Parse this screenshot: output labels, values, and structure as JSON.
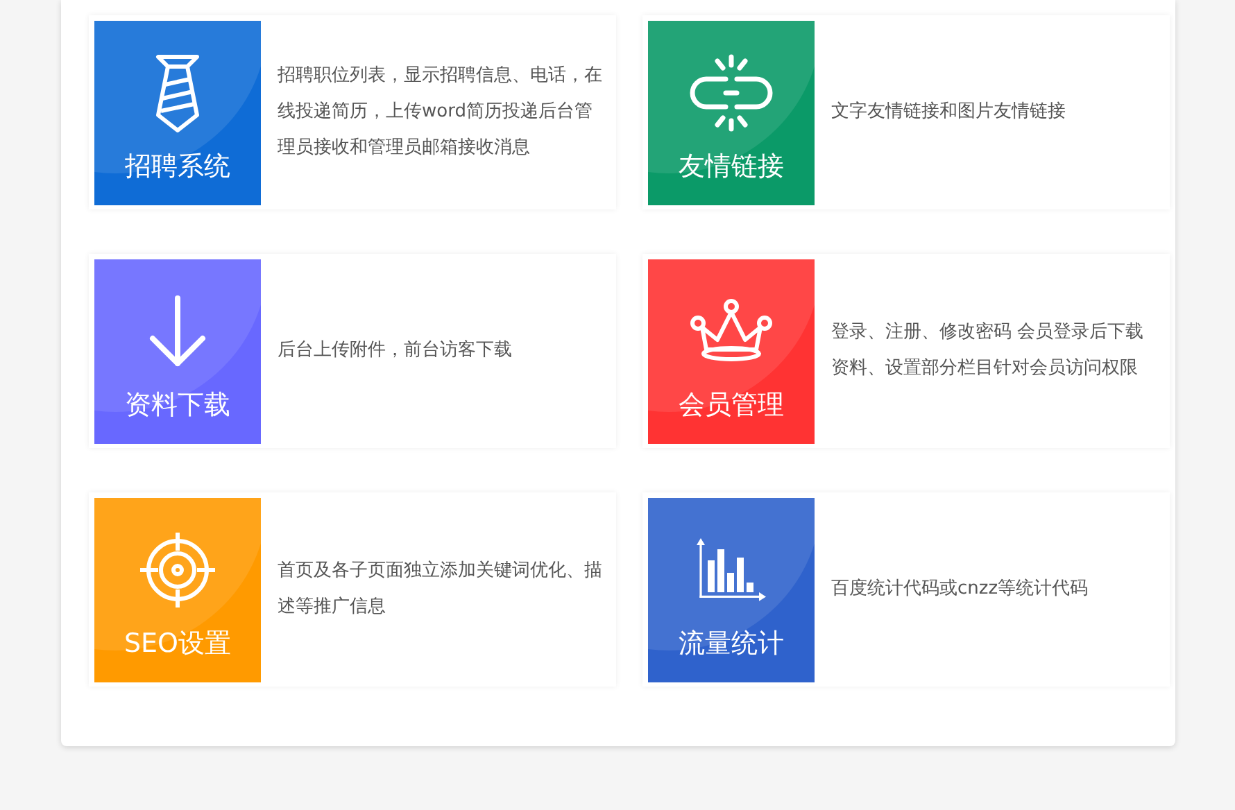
{
  "features": [
    {
      "kind": "tie",
      "title": "招聘系统",
      "color": "#0f6cd6",
      "description": "招聘职位列表，显示招聘信息、电话，在线投递简历，上传word简历投递后台管理员接收和管理员邮箱接收消息"
    },
    {
      "kind": "link",
      "title": "友情链接",
      "color": "#0b9a68",
      "description": "文字友情链接和图片友情链接"
    },
    {
      "kind": "download",
      "title": "资料下载",
      "color": "#6868ff",
      "description": "后台上传附件，前台访客下载"
    },
    {
      "kind": "crown",
      "title": "会员管理",
      "color": "#ff3333",
      "description": "登录、注册、修改密码 会员登录后下载资料、设置部分栏目针对会员访问权限"
    },
    {
      "kind": "target",
      "title": "SEO设置",
      "color": "#ff9a00",
      "description": "首页及各子页面独立添加关键词优化、描述等推广信息"
    },
    {
      "kind": "chart",
      "title": "流量统计",
      "color": "#2f62cc",
      "description": "百度统计代码或cnzz等统计代码"
    }
  ]
}
